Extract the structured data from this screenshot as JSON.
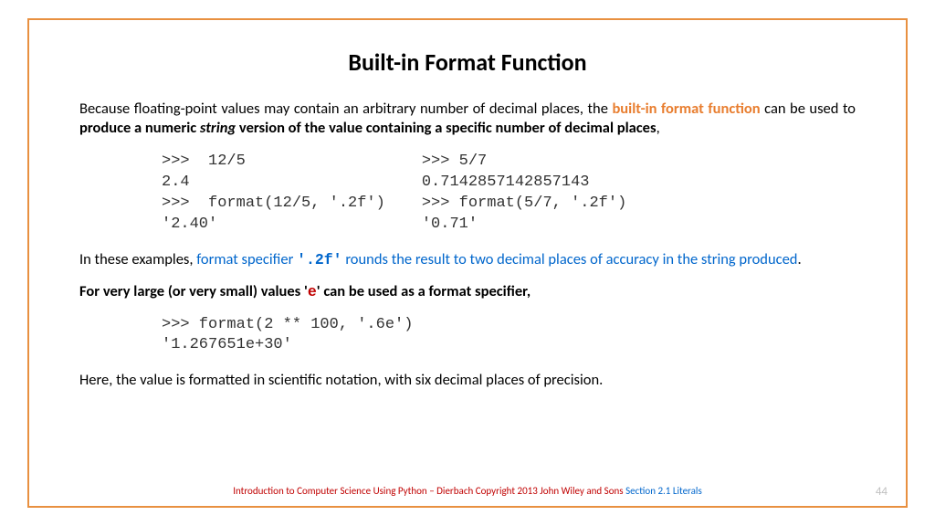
{
  "title": "Built-in Format Function",
  "para1": {
    "t1": "Because floating-point values may contain an arbitrary number of decimal places, the ",
    "t2": "built-in format function",
    "t3": " can be used to ",
    "t4": "produce a numeric ",
    "t5": "string",
    "t6": " version of the value containing a specific number of decimal places",
    "t7": ","
  },
  "code1": {
    "left": ">>>  12/5\n2.4\n>>>  format(12/5, '.2f')\n'2.40'",
    "right": ">>> 5/7\n0.7142857142857143\n>>> format(5/7, '.2f')\n'0.71'"
  },
  "para2": {
    "t1": "In these examples, ",
    "t2": "format specifier ",
    "t3": "'.2f'",
    "t4": " rounds the result to two decimal places of accuracy in the string produced",
    "t5": "."
  },
  "para3": {
    "t1": "For very large (or very small) values ",
    "t2": "'",
    "t3": "e",
    "t4": "'",
    "t5": " can be used as a format specifier,"
  },
  "code2": ">>> format(2 ** 100, '.6e')\n'1.267651e+30'",
  "para4": "Here, the value is formatted in scientific notation, with six decimal places of precision.",
  "footer": {
    "red": "Introduction to Computer Science Using Python – Dierbach    Copyright 2013 John Wiley and Sons",
    "blue": "   Section 2.1  Literals"
  },
  "page": "44"
}
